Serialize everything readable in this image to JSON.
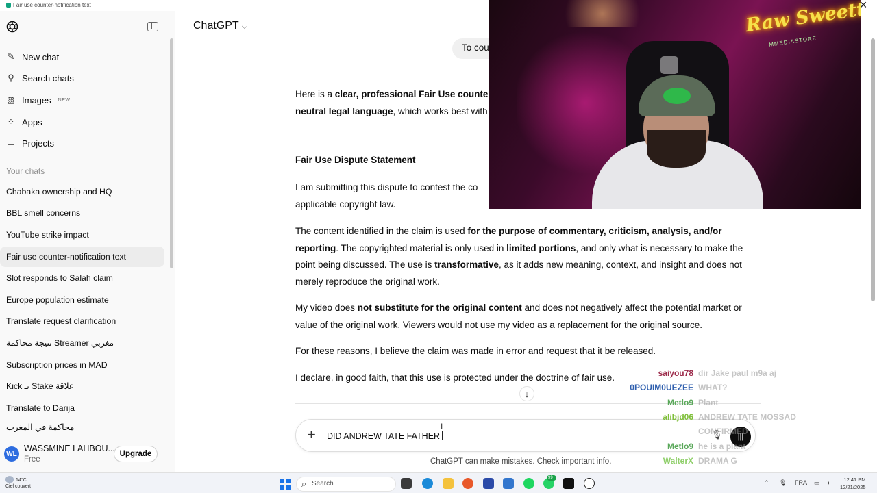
{
  "window": {
    "title": "Fair use counter-notification text",
    "close": "✕"
  },
  "sidebar": {
    "nav": [
      {
        "label": "New chat",
        "icon": "new-chat-icon",
        "glyph": "✎"
      },
      {
        "label": "Search chats",
        "icon": "search-icon",
        "glyph": "⚲"
      },
      {
        "label": "Images",
        "icon": "image-icon",
        "glyph": "▧",
        "badge": "NEW"
      },
      {
        "label": "Apps",
        "icon": "apps-icon",
        "glyph": "⁘"
      },
      {
        "label": "Projects",
        "icon": "folder-icon",
        "glyph": "▭"
      }
    ],
    "section_label": "Your chats",
    "chats": [
      "Chabaka ownership and HQ",
      "BBL smell concerns",
      "YouTube strike impact",
      "Fair use counter-notification text",
      "Slot responds to Salah claim",
      "Europe population estimate",
      "Translate request clarification",
      "نتيجة محاكمة Streamer مغربي",
      "Subscription prices in MAD",
      "Kick بـ Stake علاقة",
      "Translate to Darija",
      "محاكمة في المغرب"
    ],
    "active_chat": 3,
    "user": {
      "initials": "WL",
      "name": "WASSMINE LAHBOU...",
      "plan": "Free",
      "upgrade_label": "Upgrade"
    }
  },
  "header": {
    "model": "ChatGPT",
    "chevron": "⌵"
  },
  "conversation": {
    "user_message": "To cou",
    "intro_1": "Here is a ",
    "intro_2": "clear, professional Fair Use counter-",
    "intro_3": "neutral legal language",
    "intro_4": ", which works best with",
    "heading": "Fair Use Dispute Statement",
    "p1_line1": "I am submitting this dispute to contest the co",
    "p1_line2": "applicable copyright law.",
    "p2": {
      "a": "The content identified in the claim is used ",
      "b": "for the purpose of commentary, criticism, analysis, and/or reporting",
      "c": ". The copyrighted material is only used in ",
      "d": "limited portions",
      "e": ", and only what is necessary to make the point being discussed. The use is ",
      "f": "transformative",
      "g": ", as it adds new meaning, context, and insight and does not merely reproduce the original work."
    },
    "p3": {
      "a": "My video does ",
      "b": "not substitute for the original content",
      "c": " and does not negatively affect the potential market or value of the original work. Viewers would not use my video as a replacement for the original source."
    },
    "p4": "For these reasons, I believe the claim was made in error and request that it be released.",
    "p5": "I declare, in good faith, that this use is protected under the doctrine of fair use."
  },
  "composer": {
    "plus": "+",
    "value": "DID ANDREW TATE FATHER",
    "mic": "🎙",
    "voice": "|||"
  },
  "disclaimer": "ChatGPT can make mistakes. Check important info.",
  "scroll_down": "↓",
  "webcam": {
    "neon_text": "Raw Sweett",
    "neon_sub": "MMEDIASTORE"
  },
  "stream_chat": [
    {
      "user": "saiyou78",
      "color": "#9c2a4a",
      "text": "dir Jake paul m9a aj"
    },
    {
      "user": "0POUIM0UEZEE",
      "color": "#2f5fae",
      "text": "WHAT?"
    },
    {
      "user": "Metlo9",
      "color": "#5aa85a",
      "text": "Plant"
    },
    {
      "user": "alibjd06",
      "color": "#7fbf3a",
      "text": "ANDREW TATE MOSSAD"
    },
    {
      "user": "",
      "color": "#999999",
      "text": "CONFIRMED"
    },
    {
      "user": "Metlo9",
      "color": "#5aa85a",
      "text": "he is a plant"
    },
    {
      "user": "WalterX",
      "color": "#8fcf6a",
      "text": "DRAMA G"
    }
  ],
  "taskbar": {
    "weather_temp": "14°C",
    "weather_desc": "Ciel couvert",
    "search_placeholder": "Search",
    "badge": "99+",
    "lang": "FRA",
    "time": "12:41 PM",
    "date": "12/21/2025"
  }
}
